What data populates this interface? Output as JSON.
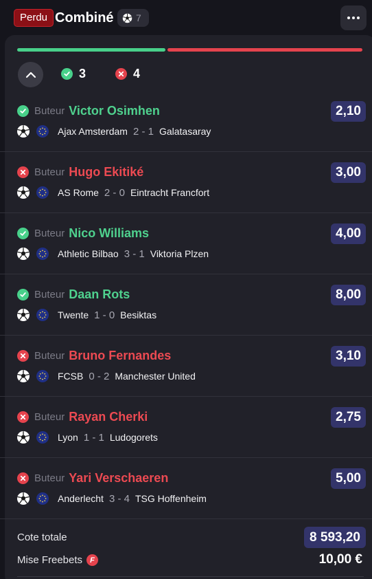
{
  "header": {
    "status_badge": "Perdu",
    "title": "Combiné",
    "sport_icon": "soccer-ball-icon",
    "selection_count": "7",
    "more_icon": "more-dots-icon"
  },
  "summary": {
    "won_count": "3",
    "lost_count": "4",
    "won_fraction": 0.43
  },
  "selections": [
    {
      "status": "won",
      "market": "Buteur",
      "player": "Victor Osimhen",
      "odds": "2,10",
      "home": "Ajax Amsterdam",
      "score": "2 - 1",
      "away": "Galatasaray"
    },
    {
      "status": "lost",
      "market": "Buteur",
      "player": "Hugo Ekitiké",
      "odds": "3,00",
      "home": "AS Rome",
      "score": "2 - 0",
      "away": "Eintracht Francfort"
    },
    {
      "status": "won",
      "market": "Buteur",
      "player": "Nico Williams",
      "odds": "4,00",
      "home": "Athletic Bilbao",
      "score": "3 - 1",
      "away": "Viktoria Plzen"
    },
    {
      "status": "won",
      "market": "Buteur",
      "player": "Daan Rots",
      "odds": "8,00",
      "home": "Twente",
      "score": "1 - 0",
      "away": "Besiktas"
    },
    {
      "status": "lost",
      "market": "Buteur",
      "player": "Bruno Fernandes",
      "odds": "3,10",
      "home": "FCSB",
      "score": "0 - 2",
      "away": "Manchester United"
    },
    {
      "status": "lost",
      "market": "Buteur",
      "player": "Rayan Cherki",
      "odds": "2,75",
      "home": "Lyon",
      "score": "1 - 1",
      "away": "Ludogorets"
    },
    {
      "status": "lost",
      "market": "Buteur",
      "player": "Yari Verschaeren",
      "odds": "5,00",
      "home": "Anderlecht",
      "score": "3 - 4",
      "away": "TSG Hoffenheim"
    }
  ],
  "totals": {
    "total_odds_label": "Cote totale",
    "total_odds_value": "8 593,20",
    "stake_label": "Mise Freebets",
    "freebet_icon_letter": "F",
    "stake_value": "10,00 €"
  },
  "colors": {
    "won": "#48d08a",
    "lost": "#e5434d",
    "odds_bg": "#33346a",
    "badge_bg": "#8b1016"
  }
}
